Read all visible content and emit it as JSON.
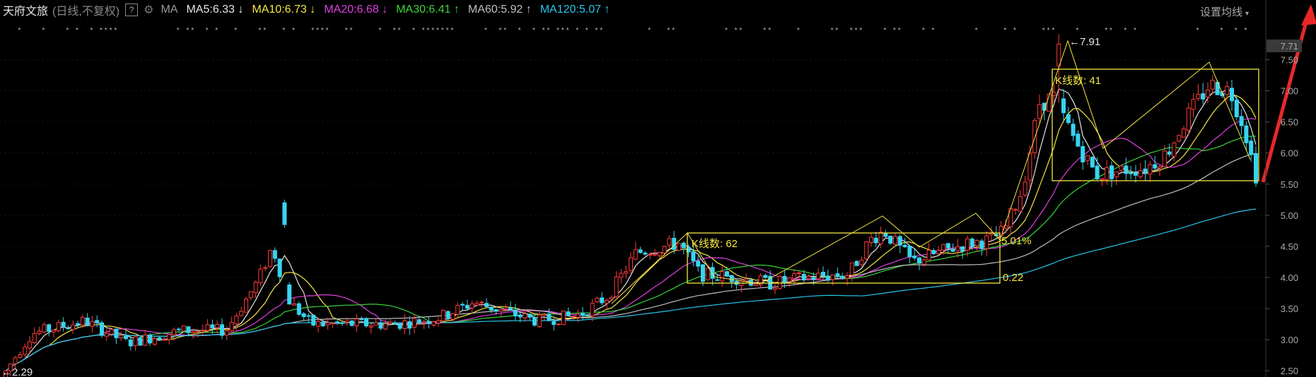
{
  "header": {
    "stock_name": "天府文旅",
    "period": "(日线,不复权)",
    "help": "?",
    "ma_label": "MA",
    "ma_items": [
      {
        "label": "MA5:6.33",
        "arrow": "↓",
        "color": "#e6e6e6"
      },
      {
        "label": "MA10:6.73",
        "arrow": "↓",
        "color": "#f5e642"
      },
      {
        "label": "MA20:6.68",
        "arrow": "↓",
        "color": "#e040e0"
      },
      {
        "label": "MA30:6.41",
        "arrow": "↑",
        "color": "#3ad23a"
      },
      {
        "label": "MA60:5.92",
        "arrow": "↑",
        "color": "#bfbfbf"
      },
      {
        "label": "MA120:5.07",
        "arrow": "↑",
        "color": "#29c4e8"
      }
    ],
    "setting_label": "设置均线",
    "gear_icon": "gear-icon"
  },
  "chart_data": {
    "type": "candlestick",
    "y_axis": {
      "ticks": [
        "7.50",
        "7.00",
        "6.50",
        "6.00",
        "5.50",
        "5.00",
        "4.50",
        "4.00",
        "3.50",
        "3.00",
        "2.50"
      ],
      "current_price": "7.71",
      "ylim": [
        2.4,
        8.05
      ]
    },
    "annotations": {
      "high_marker": "7.91",
      "low_marker": "2.29",
      "box1_kcount": "K线数: 62",
      "box1_pct": "5.01%",
      "box1_diff": "0.22",
      "box2_kcount": "K线数: 41"
    },
    "colors": {
      "up": "#ff3b3b",
      "down": "#37d4f0",
      "box": "#f5e642",
      "arrow": "#e82828"
    }
  }
}
